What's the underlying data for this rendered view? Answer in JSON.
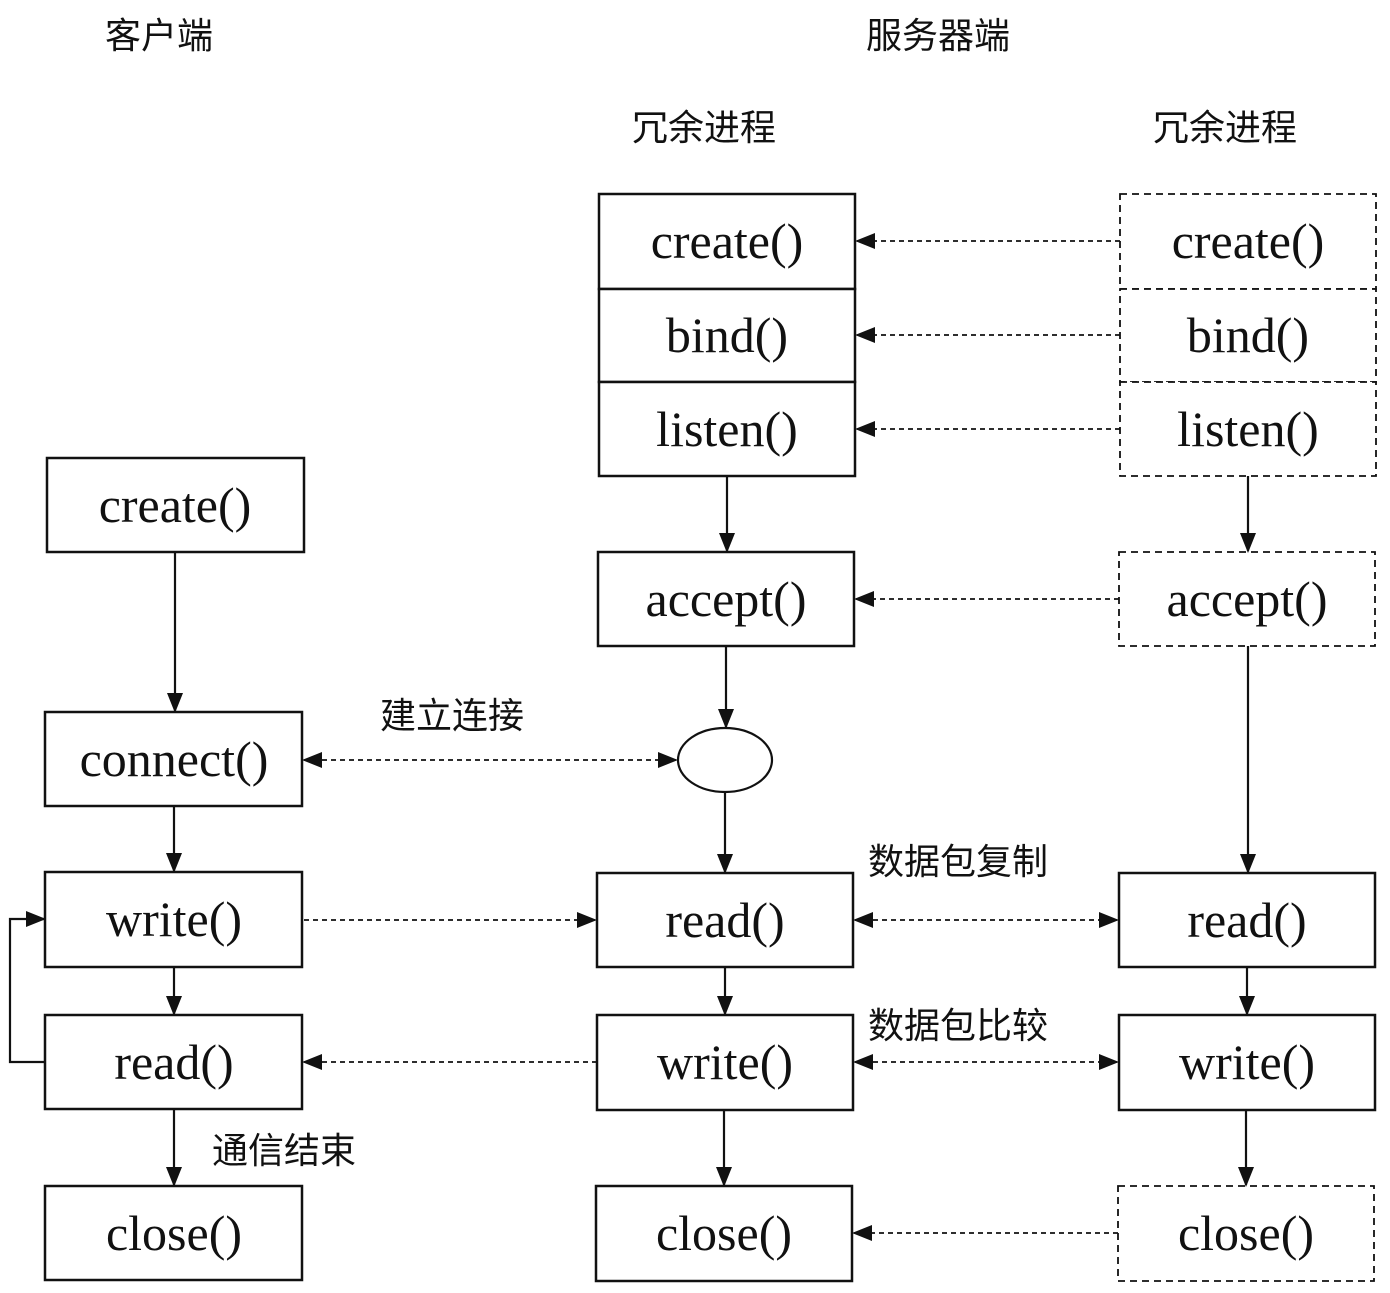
{
  "headers": {
    "client": "客户端",
    "server": "服务器端",
    "redundant_left": "冗余进程",
    "redundant_right": "冗余进程"
  },
  "client": {
    "create": "create()",
    "connect": "connect()",
    "write": "write()",
    "read": "read()",
    "close": "close()"
  },
  "server_primary": {
    "create": "create()",
    "bind": "bind()",
    "listen": "listen()",
    "accept": "accept()",
    "read": "read()",
    "write": "write()",
    "close": "close()"
  },
  "server_redundant": {
    "create": "create()",
    "bind": "bind()",
    "listen": "listen()",
    "accept": "accept()",
    "read": "read()",
    "write": "write()",
    "close": "close()"
  },
  "annotations": {
    "establish_connection": "建立连接",
    "packet_copy": "数据包复制",
    "packet_compare": "数据包比较",
    "communication_end": "通信结束"
  }
}
